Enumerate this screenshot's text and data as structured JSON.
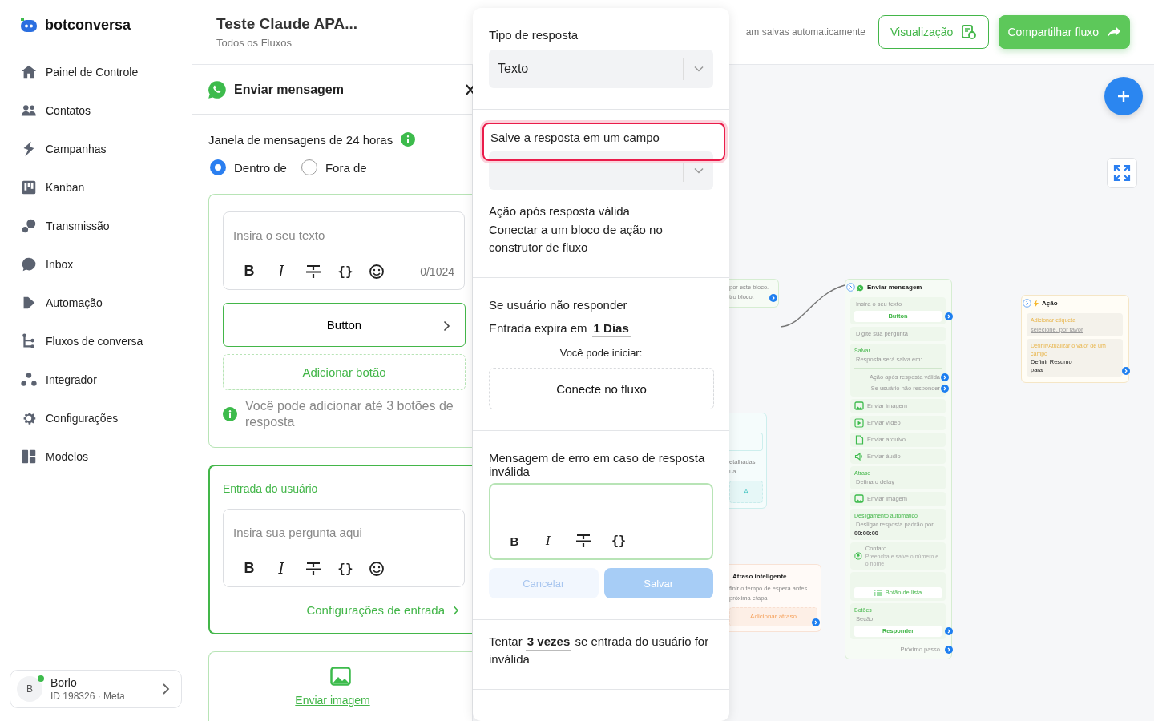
{
  "brand": {
    "name": "botconversa"
  },
  "sidebar": {
    "items": [
      {
        "label": "Painel de Controle",
        "selected": false
      },
      {
        "label": "Contatos",
        "selected": false
      },
      {
        "label": "Campanhas",
        "selected": false
      },
      {
        "label": "Kanban",
        "selected": false
      },
      {
        "label": "Transmissão",
        "selected": false
      },
      {
        "label": "Inbox",
        "selected": false
      },
      {
        "label": "Automação",
        "selected": false
      },
      {
        "label": "Fluxos de conversa",
        "selected": false
      },
      {
        "label": "Integrador",
        "selected": false
      },
      {
        "label": "Configurações",
        "selected": false
      },
      {
        "label": "Modelos",
        "selected": false
      }
    ]
  },
  "account": {
    "initial": "B",
    "name": "Borlo",
    "detail": "ID 198326 · Meta",
    "online": true
  },
  "header": {
    "title": "Teste Claude APA...",
    "subtitle": "Todos os Fluxos",
    "autosave_note": "am salvas automaticamente",
    "buttons": [
      {
        "label": "Visualização",
        "kind": "outline"
      },
      {
        "label": "Compartilhar fluxo",
        "kind": "primary"
      }
    ]
  },
  "editor_panel": {
    "title": "Enviar mensagem",
    "window_label": "Janela de mensagens de 24 horas",
    "window_options": [
      {
        "label": "Dentro de",
        "selected": true
      },
      {
        "label": "Fora de",
        "selected": false
      }
    ],
    "message_card": {
      "placeholder": "Insira o seu texto",
      "tools": [
        {
          "kind": "bold",
          "text": "B"
        },
        {
          "kind": "italic",
          "text": "I"
        },
        {
          "kind": "strike"
        },
        {
          "kind": "code",
          "text": "{}"
        },
        {
          "kind": "emoji"
        }
      ],
      "counter": "0/1024",
      "buttons": [
        "Button"
      ],
      "add_button": "Adicionar botão",
      "hint": "Você pode adicionar até 3 botões de resposta"
    },
    "input_card": {
      "title": "Entrada do usuário",
      "placeholder": "Insira sua pergunta aqui",
      "tools": [
        {
          "kind": "bold",
          "text": "B"
        },
        {
          "kind": "italic",
          "text": "I"
        },
        {
          "kind": "strike"
        },
        {
          "kind": "code",
          "text": "{}"
        },
        {
          "kind": "emoji"
        }
      ],
      "settings_link": "Configurações de entrada"
    },
    "image_card": {
      "label": "Enviar imagem"
    }
  },
  "response_popup": {
    "type_label": "Tipo de resposta",
    "type_value": "Texto",
    "save_label": "Salve a resposta em um campo",
    "save_highlighted": true,
    "valid_title": "Ação após resposta válida",
    "valid_text": "Conectar a um bloco de ação no construtor de fluxo",
    "timeout_title": "Se usuário não responder",
    "expires_prefix": "Entrada expira em",
    "expires_value": "1 Dias",
    "start_label": "Você pode iniciar:",
    "connect_label": "Conecte no fluxo",
    "error_title": "Mensagem de erro em caso de resposta inválida",
    "error_tools": [
      {
        "kind": "bold",
        "text": "B"
      },
      {
        "kind": "italic",
        "text": "I"
      },
      {
        "kind": "strike"
      },
      {
        "kind": "code",
        "text": "{}"
      }
    ],
    "error_buttons": [
      {
        "label": "Cancelar",
        "kind": "secondary",
        "disabled": true
      },
      {
        "label": "Salvar",
        "kind": "primary",
        "disabled": true
      }
    ],
    "retry_prefix": "Tentar",
    "retry_value": "3 vezes",
    "retry_suffix": "se entrada do usuário for inválida"
  },
  "canvas": {
    "nodes": [
      {
        "kind": "message",
        "cut": true,
        "port": true,
        "items": [
          {
            "kind": "text",
            "text": "por este bloco."
          },
          {
            "kind": "text",
            "text": "tro bloco."
          }
        ]
      },
      {
        "kind": "ai",
        "cut": true,
        "port": false,
        "items": [
          {
            "kind": "input"
          },
          {
            "kind": "text",
            "text": "etalhadas"
          },
          {
            "kind": "text",
            "text": "ua"
          },
          {
            "kind": "dashed",
            "text": "A"
          }
        ]
      },
      {
        "kind": "delay",
        "cut": true,
        "port": true,
        "items": [
          {
            "kind": "title",
            "text": "Atraso inteligente"
          },
          {
            "kind": "text",
            "text": "finir o tempo de espera antes"
          },
          {
            "kind": "text",
            "text": "próxima etapa"
          },
          {
            "kind": "dashed",
            "text": "Adicionar atraso"
          }
        ]
      },
      {
        "kind": "message",
        "cut": false,
        "port": false,
        "items": [
          {
            "kind": "heading",
            "text": "Enviar mensagem"
          },
          {
            "kind": "section",
            "items": [
              {
                "kind": "text",
                "text": "Insira o seu texto"
              },
              {
                "kind": "button",
                "text": "Button",
                "port": true
              }
            ]
          },
          {
            "kind": "section",
            "items": [
              {
                "kind": "text",
                "text": "Digite sua pergunta"
              }
            ]
          },
          {
            "kind": "section",
            "items": [
              {
                "kind": "label",
                "text": "Salvar"
              },
              {
                "kind": "text",
                "text": "Resposta será salva em:"
              },
              {
                "kind": "rule"
              },
              {
                "kind": "link",
                "text": "Ação após resposta válida",
                "port": true
              },
              {
                "kind": "link",
                "text": "Se usuário não responder",
                "port": true
              }
            ]
          },
          {
            "kind": "image-row",
            "text": "Enviar imagem"
          },
          {
            "kind": "video-row",
            "text": "Enviar vídeo"
          },
          {
            "kind": "file-row",
            "text": "Enviar arquivo"
          },
          {
            "kind": "audio-row",
            "text": "Enviar áudio"
          },
          {
            "kind": "section",
            "items": [
              {
                "kind": "label",
                "text": "Atraso"
              },
              {
                "kind": "text",
                "text": "Defina o delay"
              }
            ]
          },
          {
            "kind": "image-row",
            "text": "Enviar imagem"
          },
          {
            "kind": "section",
            "items": [
              {
                "kind": "label",
                "text": "Desligamento automático"
              },
              {
                "kind": "text",
                "text": "Desligar resposta padrão por"
              },
              {
                "kind": "value",
                "text": "00:00:00"
              }
            ]
          },
          {
            "kind": "contact-row",
            "text": "Contato",
            "detail": "Preencha e salve o número e o nome"
          },
          {
            "kind": "section",
            "items": [
              {
                "kind": "list-button",
                "text": "Botão de lista"
              }
            ]
          },
          {
            "kind": "section",
            "items": [
              {
                "kind": "label",
                "text": "Botões"
              },
              {
                "kind": "text",
                "text": "Seção"
              },
              {
                "kind": "button",
                "text": "Responder",
                "port": true
              }
            ]
          },
          {
            "kind": "link",
            "text": "Próximo passo",
            "port": true
          }
        ]
      },
      {
        "kind": "action",
        "cut": false,
        "port": false,
        "items": [
          {
            "kind": "heading",
            "text": "Ação"
          },
          {
            "kind": "section",
            "items": [
              {
                "kind": "label",
                "text": "Adicionar etiqueta"
              },
              {
                "kind": "placeholder",
                "text": "selecione, por favor"
              }
            ]
          },
          {
            "kind": "section",
            "port": true,
            "items": [
              {
                "kind": "label",
                "text": "Definir/Atualizar o valor de um campo"
              },
              {
                "kind": "dark",
                "text": "Definir Resumo"
              },
              {
                "kind": "dark",
                "text": "para"
              }
            ]
          }
        ]
      }
    ]
  }
}
